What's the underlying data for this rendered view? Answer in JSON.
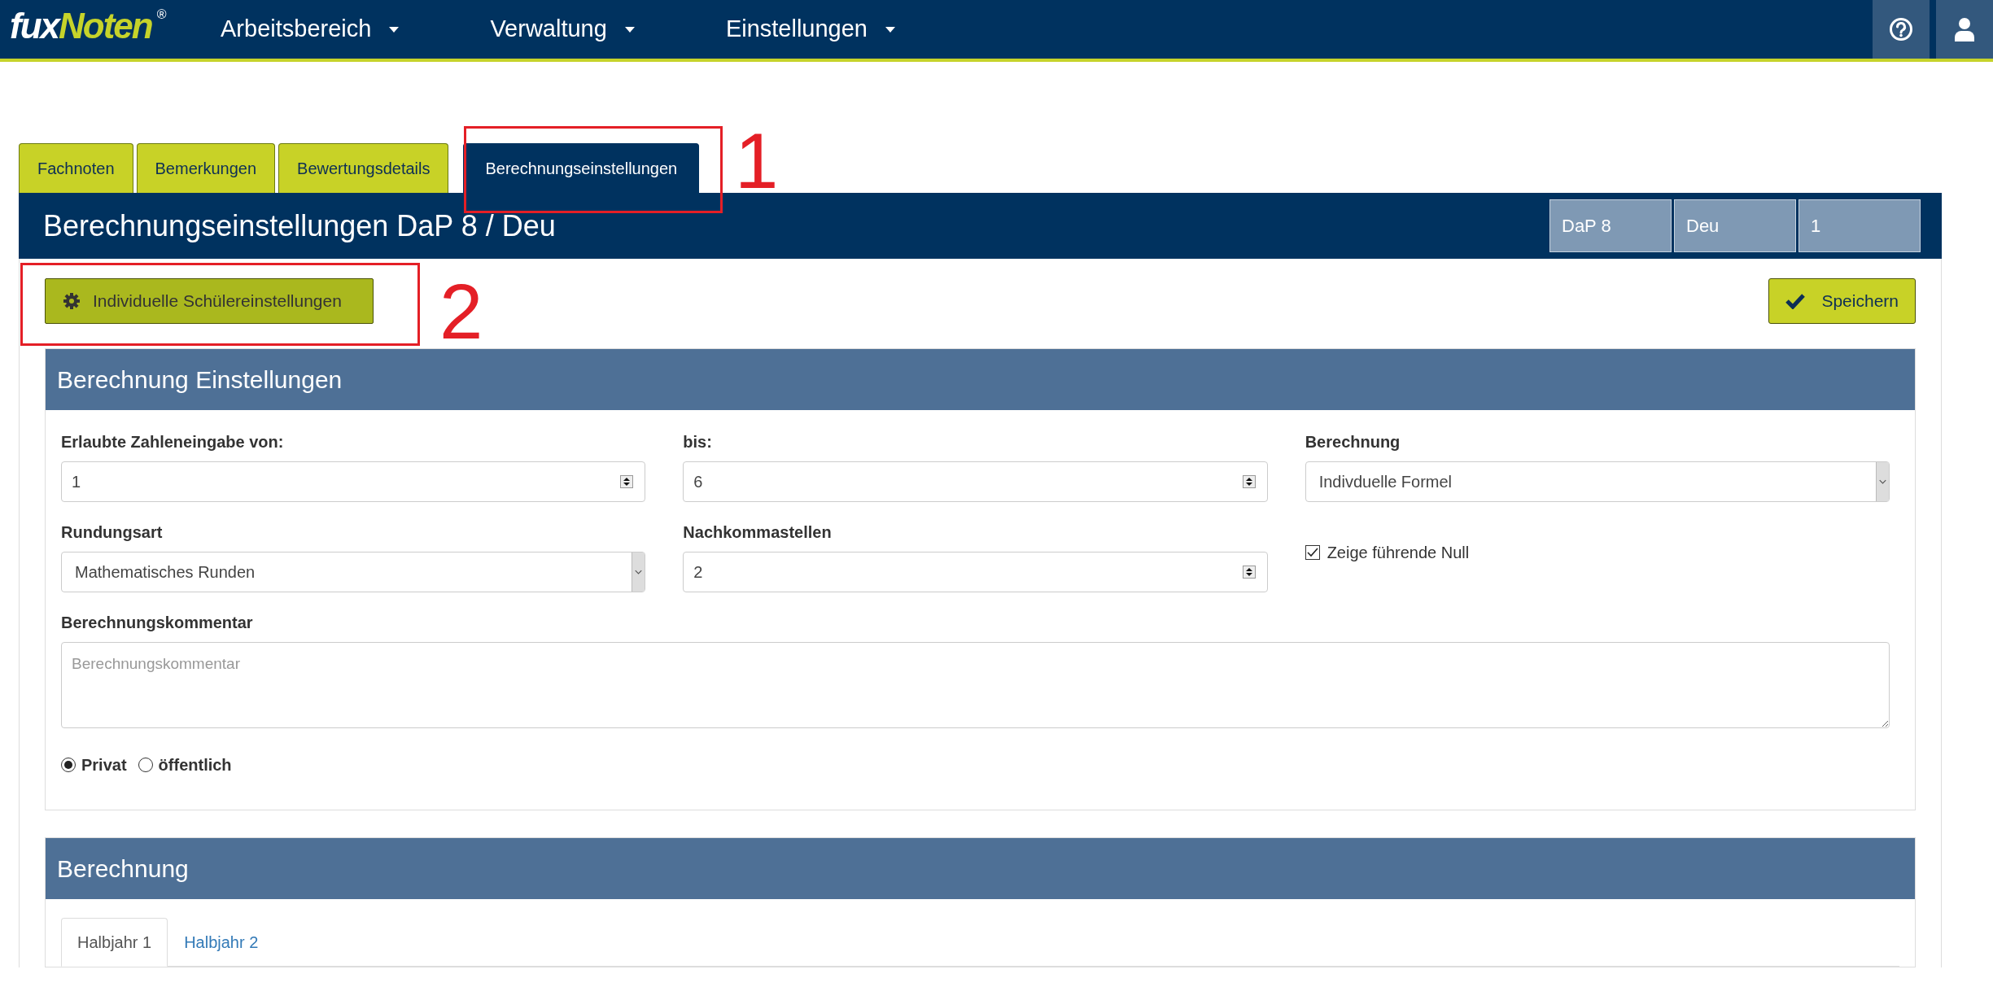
{
  "logo": {
    "part1": "fux",
    "part2": "Noten",
    "mark": "®"
  },
  "menus": [
    {
      "label": "Arbeitsbereich"
    },
    {
      "label": "Verwaltung"
    },
    {
      "label": "Einstellungen"
    }
  ],
  "tabs": [
    {
      "label": "Fachnoten",
      "selected": false
    },
    {
      "label": "Bemerkungen",
      "selected": false
    },
    {
      "label": "Bewertungsdetails",
      "selected": false
    },
    {
      "label": "Berechnungseinstellungen",
      "selected": true
    }
  ],
  "header": {
    "title": "Berechnungseinstellungen DaP 8 / Deu",
    "badges": [
      "DaP 8",
      "Deu",
      "1"
    ]
  },
  "toolbar": {
    "student_settings_button": "Individuelle Schülereinstellungen",
    "save_button": "Speichern"
  },
  "settings_panel": {
    "title": "Berechnung Einstellungen",
    "fields": [
      {
        "kind": "number",
        "label": "Erlaubte Zahleneingabe von:",
        "value": "1"
      },
      {
        "kind": "number",
        "label": "bis:",
        "value": "6"
      },
      {
        "kind": "select",
        "label": "Berechnung",
        "value": "Indivduelle Formel"
      },
      {
        "kind": "select",
        "label": "Rundungsart",
        "value": "Mathematisches Runden"
      },
      {
        "kind": "number",
        "label": "Nachkommastellen",
        "value": "2"
      },
      {
        "kind": "checkbox",
        "label": "Zeige führende Null",
        "checked": true
      }
    ],
    "comment": {
      "label": "Berechnungskommentar",
      "placeholder": "Berechnungskommentar"
    },
    "visibility": [
      {
        "label": "Privat",
        "selected": true
      },
      {
        "label": "öffentlich",
        "selected": false
      }
    ]
  },
  "calc_panel": {
    "title": "Berechnung",
    "tabs": [
      {
        "label": "Halbjahr 1",
        "selected": true
      },
      {
        "label": "Halbjahr 2",
        "selected": false
      }
    ]
  },
  "annotations": [
    {
      "label": "1"
    },
    {
      "label": "2"
    }
  ]
}
